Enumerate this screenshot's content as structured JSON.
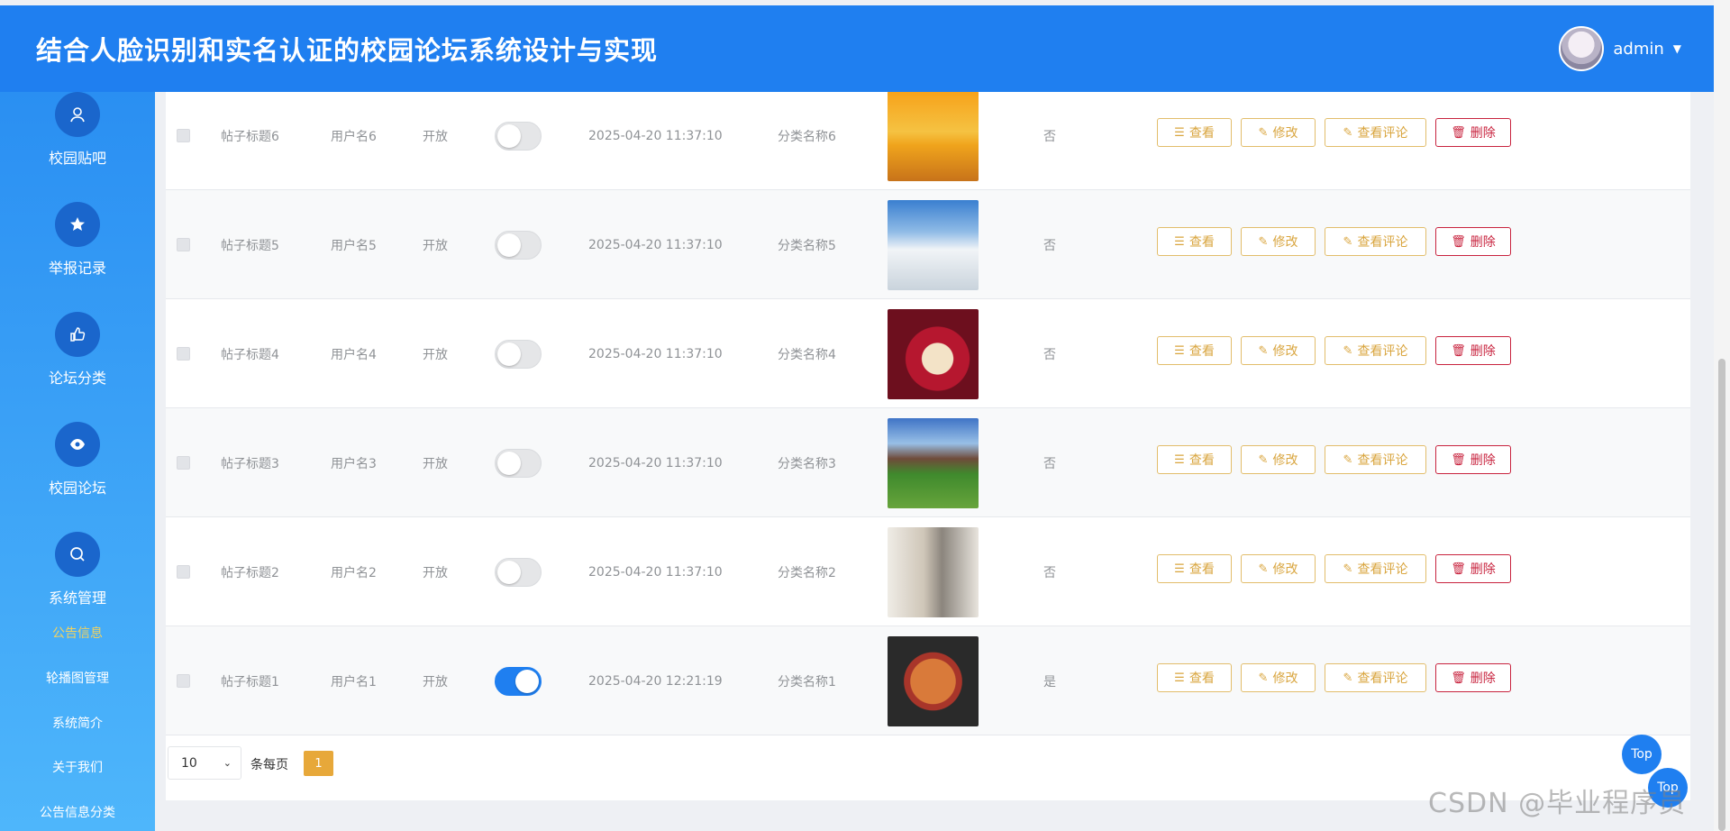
{
  "header": {
    "title": "结合人脸识别和实名认证的校园论坛系统设计与实现",
    "username": "admin"
  },
  "sidebar": {
    "menu": [
      {
        "label": "校园贴吧",
        "icon": "user-icon"
      },
      {
        "label": "举报记录",
        "icon": "star-icon"
      },
      {
        "label": "论坛分类",
        "icon": "thumbs-up-icon"
      },
      {
        "label": "校园论坛",
        "icon": "eye-icon"
      },
      {
        "label": "系统管理",
        "icon": "search-icon"
      }
    ],
    "submenu": [
      "公告信息",
      "轮播图管理",
      "系统简介",
      "关于我们",
      "公告信息分类"
    ],
    "active_submenu": "公告信息"
  },
  "table": {
    "rows": [
      {
        "title": "帖子标题6",
        "user": "用户名6",
        "status": "开放",
        "toggle": false,
        "time": "2025-04-20 11:37:10",
        "category": "分类名称6",
        "flag": "否"
      },
      {
        "title": "帖子标题5",
        "user": "用户名5",
        "status": "开放",
        "toggle": false,
        "time": "2025-04-20 11:37:10",
        "category": "分类名称5",
        "flag": "否"
      },
      {
        "title": "帖子标题4",
        "user": "用户名4",
        "status": "开放",
        "toggle": false,
        "time": "2025-04-20 11:37:10",
        "category": "分类名称4",
        "flag": "否"
      },
      {
        "title": "帖子标题3",
        "user": "用户名3",
        "status": "开放",
        "toggle": false,
        "time": "2025-04-20 11:37:10",
        "category": "分类名称3",
        "flag": "否"
      },
      {
        "title": "帖子标题2",
        "user": "用户名2",
        "status": "开放",
        "toggle": false,
        "time": "2025-04-20 11:37:10",
        "category": "分类名称2",
        "flag": "否"
      },
      {
        "title": "帖子标题1",
        "user": "用户名1",
        "status": "开放",
        "toggle": true,
        "time": "2025-04-20 12:21:19",
        "category": "分类名称1",
        "flag": "是"
      }
    ],
    "actions": {
      "view": "查看",
      "edit": "修改",
      "comments": "查看评论",
      "delete": "删除"
    }
  },
  "pagination": {
    "page_size": "10",
    "page_size_label": "条每页",
    "current_page": "1"
  },
  "top_button": "Top",
  "watermark": "CSDN @毕业程序员",
  "colors": {
    "header": "#1f7ff0",
    "accent": "#e7a83a",
    "danger": "#c8233e",
    "active_menu": "#f1d260"
  }
}
